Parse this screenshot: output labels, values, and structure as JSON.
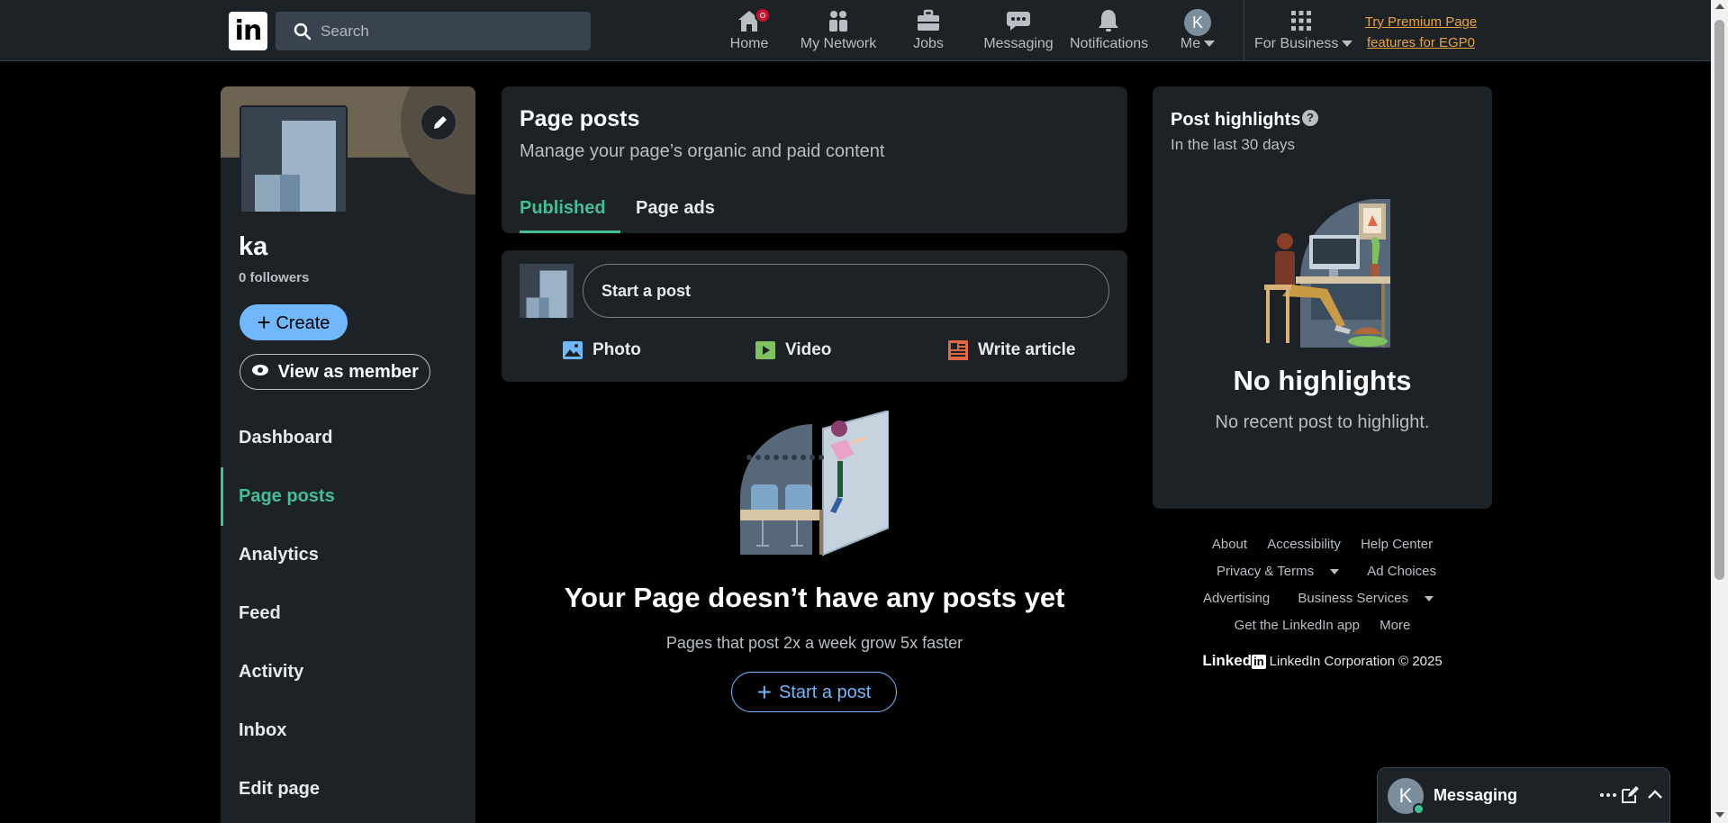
{
  "nav": {
    "logo": "in",
    "search_placeholder": "Search",
    "items": [
      {
        "label": "Home",
        "icon": "home-icon"
      },
      {
        "label": "My Network",
        "icon": "people-icon"
      },
      {
        "label": "Jobs",
        "icon": "briefcase-icon"
      },
      {
        "label": "Messaging",
        "icon": "chat-icon"
      },
      {
        "label": "Notifications",
        "icon": "bell-icon"
      },
      {
        "label": "Me",
        "icon": "avatar",
        "avatar_letter": "K"
      },
      {
        "label": "For Business",
        "icon": "grid-icon"
      }
    ],
    "premium_line1": "Try Premium Page",
    "premium_line2": "features for EGP0"
  },
  "sidebar": {
    "company_name": "ka",
    "followers": "0 followers",
    "create_label": "Create",
    "view_member_label": "View as member",
    "items": [
      {
        "label": "Dashboard",
        "active": false
      },
      {
        "label": "Page posts",
        "active": true
      },
      {
        "label": "Analytics",
        "active": false
      },
      {
        "label": "Feed",
        "active": false
      },
      {
        "label": "Activity",
        "active": false
      },
      {
        "label": "Inbox",
        "active": false
      },
      {
        "label": "Edit page",
        "active": false
      }
    ]
  },
  "main": {
    "title": "Page posts",
    "subtitle": "Manage your page’s organic and paid content",
    "tabs": [
      {
        "label": "Published",
        "active": true
      },
      {
        "label": "Page ads",
        "active": false
      }
    ],
    "composer": {
      "placeholder": "Start a post",
      "actions": [
        {
          "label": "Photo",
          "icon": "photo-icon"
        },
        {
          "label": "Video",
          "icon": "video-icon"
        },
        {
          "label": "Write article",
          "icon": "article-icon"
        }
      ]
    },
    "empty": {
      "title": "Your Page doesn’t have any posts yet",
      "subtitle": "Pages that post 2x a week grow 5x faster",
      "button": "Start a post"
    }
  },
  "highlights": {
    "title": "Post highlights",
    "help": "?",
    "subtitle": "In the last 30 days",
    "empty_title": "No highlights",
    "empty_subtitle": "No recent post to highlight."
  },
  "footer": {
    "row1": [
      "About",
      "Accessibility",
      "Help Center"
    ],
    "privacy": "Privacy & Terms",
    "ad_choices": "Ad Choices",
    "advertising": "Advertising",
    "business_services": "Business Services",
    "get_app": "Get the LinkedIn app",
    "more": "More",
    "brand_word": "Linked",
    "brand_box": "in",
    "copyright": "LinkedIn Corporation © 2025"
  },
  "messaging": {
    "label": "Messaging",
    "avatar_letter": "K"
  },
  "colors": {
    "accent_green": "#44bf94",
    "accent_blue": "#71b7fb",
    "premium_gold": "#e7a33e",
    "card_bg": "#1d2226",
    "badge_red": "#cb112d"
  }
}
